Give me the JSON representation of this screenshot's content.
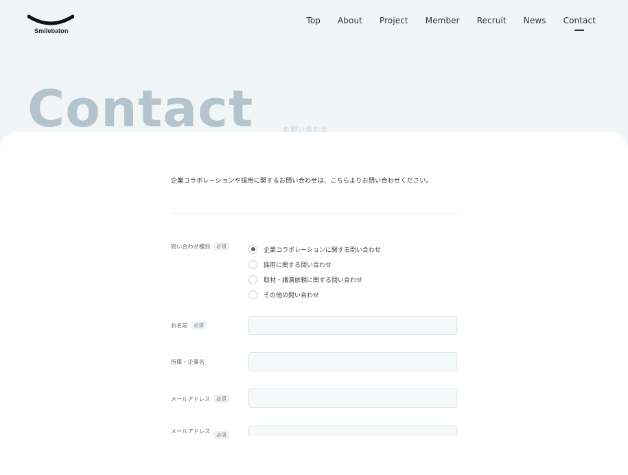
{
  "brand": {
    "name": "Smilebaton"
  },
  "nav": {
    "items": [
      {
        "label": "Top"
      },
      {
        "label": "About"
      },
      {
        "label": "Project"
      },
      {
        "label": "Member"
      },
      {
        "label": "Recruit"
      },
      {
        "label": "News"
      },
      {
        "label": "Contact",
        "active": true
      }
    ]
  },
  "hero": {
    "title": "Contact",
    "subtitle": "お問い合わせ"
  },
  "form": {
    "intro": "企業コラボレーションや採用に関するお問い合わせは、こちらよりお問い合わせください。",
    "required_label": "必須",
    "inquiry_type": {
      "label": "問い合わせ種別",
      "options": [
        {
          "label": "企業コラボレーションに関する問い合わせ",
          "checked": true
        },
        {
          "label": "採用に関する問い合わせ",
          "checked": false
        },
        {
          "label": "取材・講演依頼に関する問い合わせ",
          "checked": false
        },
        {
          "label": "その他の問い合わせ",
          "checked": false
        }
      ]
    },
    "name": {
      "label": "お名前",
      "value": ""
    },
    "company": {
      "label": "所属・企業名",
      "value": ""
    },
    "email": {
      "label": "メールアドレス",
      "value": ""
    },
    "email_confirm": {
      "label": "メールアドレス",
      "value": ""
    }
  }
}
